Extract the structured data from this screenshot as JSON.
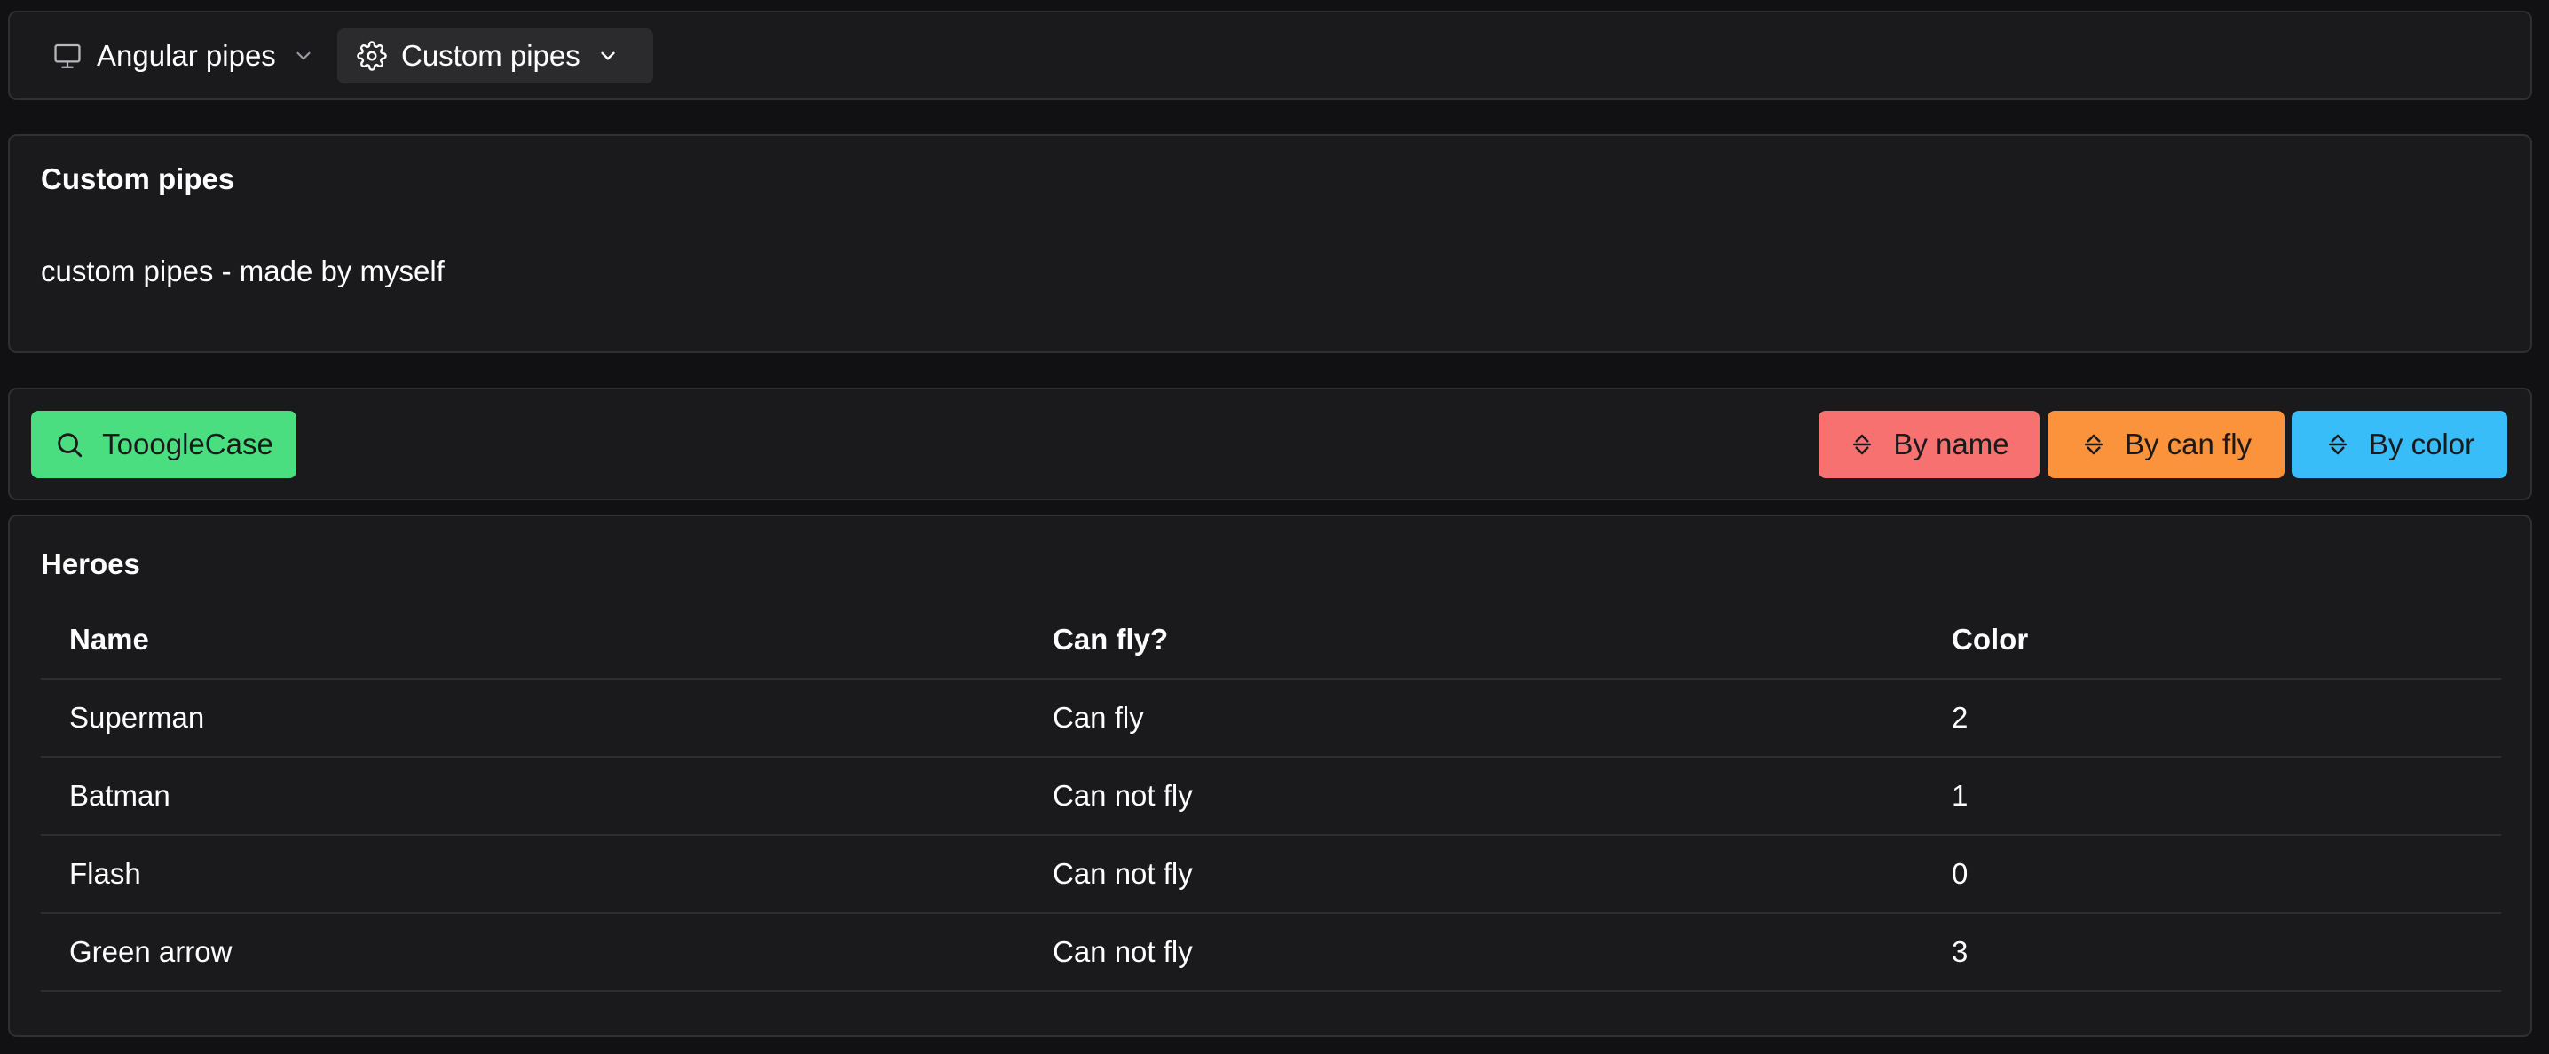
{
  "nav": {
    "items": [
      {
        "label": "Angular pipes",
        "icon": "monitor-icon",
        "active": false
      },
      {
        "label": "Custom pipes",
        "icon": "gear-icon",
        "active": true
      }
    ]
  },
  "description": {
    "title": "Custom pipes",
    "text": "custom pipes - made by myself"
  },
  "toolbar": {
    "toggle_label": "TooogleCase",
    "sort_by_name_label": "By name",
    "sort_by_can_fly_label": "By can fly",
    "sort_by_color_label": "By color"
  },
  "heroes": {
    "title": "Heroes",
    "columns": [
      "Name",
      "Can fly?",
      "Color"
    ],
    "rows": [
      [
        "Superman",
        "Can fly",
        "2"
      ],
      [
        "Batman",
        "Can not fly",
        "1"
      ],
      [
        "Flash",
        "Can not fly",
        "0"
      ],
      [
        "Green arrow",
        "Can not fly",
        "3"
      ]
    ]
  },
  "colors": {
    "background": "#111113",
    "panel": "#1a1a1c",
    "border": "#303033",
    "toggle_button": "#4ade80",
    "name_button": "#f87171",
    "can_fly_button": "#fb923c",
    "color_button": "#38bdf8"
  }
}
